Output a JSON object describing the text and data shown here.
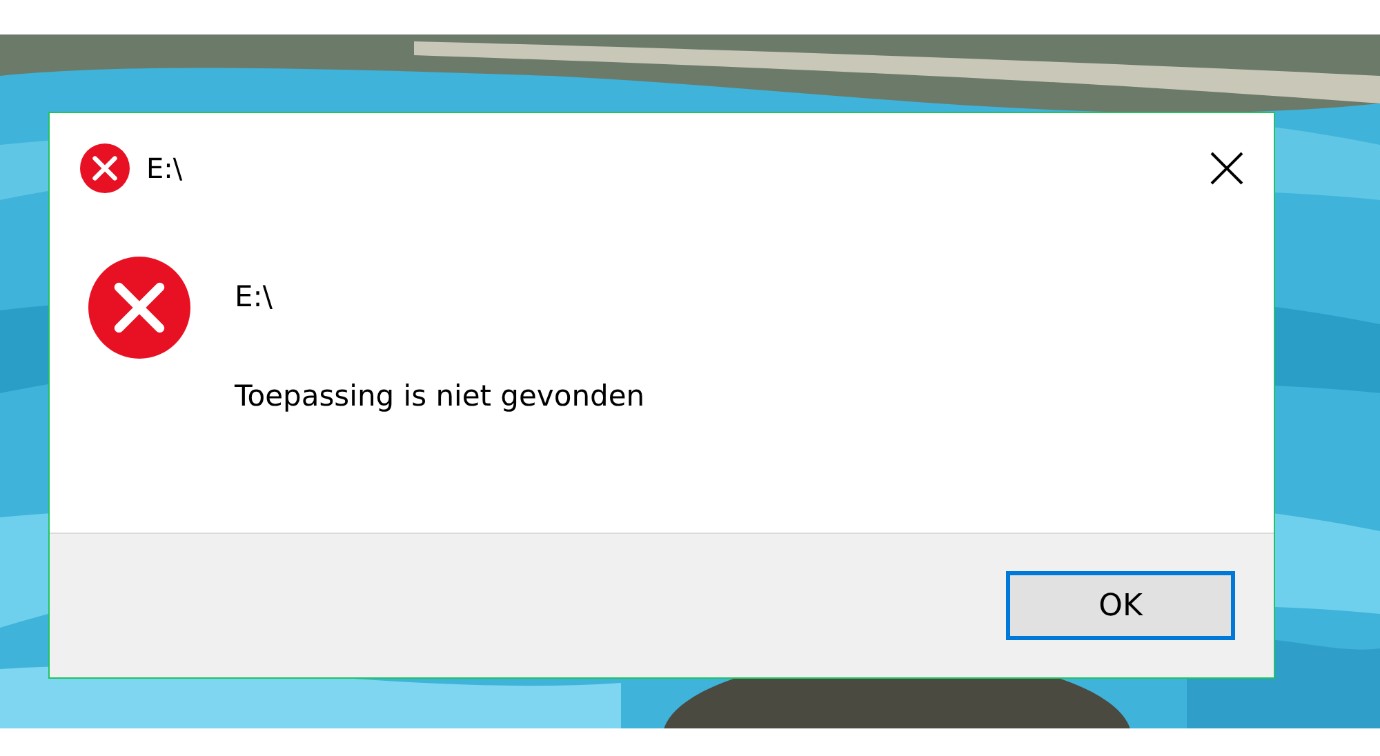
{
  "dialog": {
    "kind": "error",
    "title": "E:\\",
    "heading": "E:\\",
    "message": "Toepassing is niet gevonden",
    "buttons": [
      {
        "label": "OK",
        "focused": true
      }
    ]
  }
}
